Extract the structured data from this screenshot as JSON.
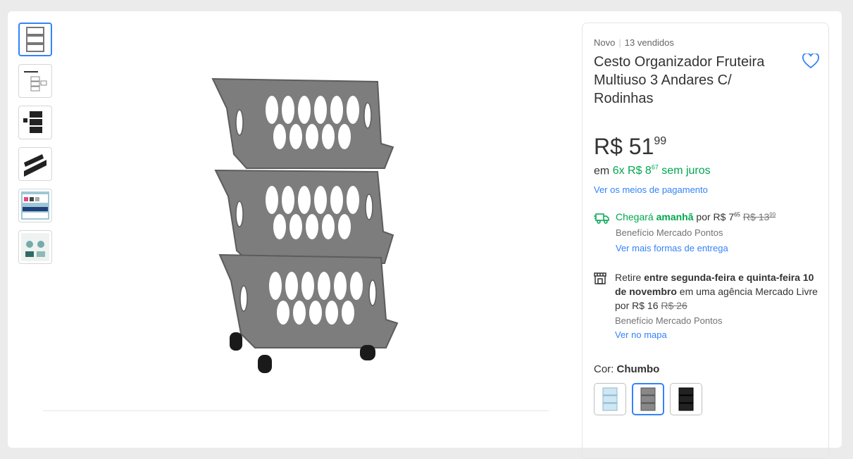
{
  "product": {
    "condition": "Novo",
    "sold": "13 vendidos",
    "title": "Cesto Organizador Fruteira Multiuso 3 Andares C/ Rodinhas"
  },
  "price": {
    "currency": "R$",
    "integer": "51",
    "cents": "99",
    "installment_prefix": "em",
    "installment_count": "6x R$ 8",
    "installment_cents": "67",
    "installment_suffix": "sem juros",
    "payment_link": "Ver os meios de pagamento"
  },
  "shipping": {
    "arrives": "Chegará",
    "when": "amanhã",
    "by": "por R$ 7",
    "by_cents": "65",
    "old_price": "R$ 13",
    "old_cents": "99",
    "benefit": "Benefício Mercado Pontos",
    "more_link": "Ver mais formas de entrega"
  },
  "pickup": {
    "line_pre": "Retire",
    "line_bold": "entre segunda-feira e quinta-feira 10 de novembro",
    "line_post": "em uma agência Mercado Livre por R$ 16",
    "old_price": "R$ 26",
    "benefit": "Benefício Mercado Pontos",
    "map_link": "Ver no mapa"
  },
  "color": {
    "label": "Cor:",
    "selected": "Chumbo",
    "swatches": [
      "Azul claro",
      "Chumbo",
      "Preto"
    ]
  },
  "colors": {
    "accent": "#3483fa",
    "green": "#00a650",
    "product_gray": "#7c7c7c"
  },
  "icons": [
    "heart-icon",
    "truck-icon",
    "store-icon"
  ]
}
